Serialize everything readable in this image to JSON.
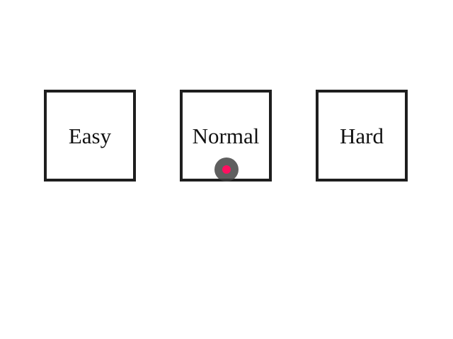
{
  "difficulty": {
    "options": [
      {
        "id": "easy",
        "label": "Easy"
      },
      {
        "id": "normal",
        "label": "Normal"
      },
      {
        "id": "hard",
        "label": "Hard"
      }
    ]
  },
  "cursor": {
    "ring_color": "#3c3c3c",
    "dot_color": "#ff1060"
  },
  "colors": {
    "box_border": "#1e1e1e",
    "background": "#ffffff",
    "text": "#111111"
  }
}
